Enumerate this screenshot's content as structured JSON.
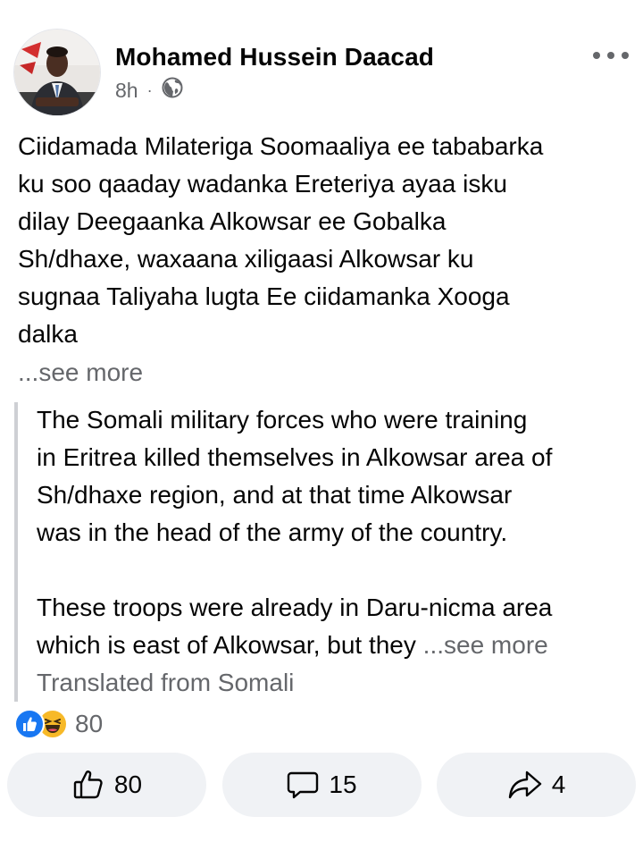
{
  "post": {
    "author": "Mohamed Hussein Daacad",
    "time": "8h",
    "separator": "·",
    "privacy_icon": "globe-icon",
    "menu_icon": "more-dots-icon",
    "text_lines": [
      "Ciidamada Milateriga Soomaaliya ee tababarka",
      "ku soo qaaday wadanka Ereteriya ayaa isku",
      "dilay Deegaanka Alkowsar ee Gobalka",
      "Sh/dhaxe, waxaana xiligaasi Alkowsar ku",
      "sugnaa Taliyaha lugta Ee ciidamanka Xooga",
      "dalka"
    ],
    "see_more": "...see more",
    "translation": {
      "lines": [
        "The Somali military forces who were training",
        "in Eritrea killed themselves in Alkowsar area of",
        "Sh/dhaxe region, and at that time Alkowsar",
        "was in the head of the army of the country."
      ],
      "lines_2": [
        "These troops were already in Daru-nicma area"
      ],
      "last_line": "which is east of Alkowsar, but they ",
      "see_more": "...see more",
      "source": "Translated from Somali"
    }
  },
  "reactions": {
    "icons": [
      "like-icon",
      "haha-icon"
    ],
    "count": "80"
  },
  "actions": {
    "like_count": "80",
    "comment_count": "15",
    "share_count": "4"
  },
  "colors": {
    "text": "#050505",
    "secondary": "#65676b",
    "like_blue": "#1877f2",
    "haha_yellow": "#f7b928",
    "button_bg": "#f0f2f5"
  }
}
